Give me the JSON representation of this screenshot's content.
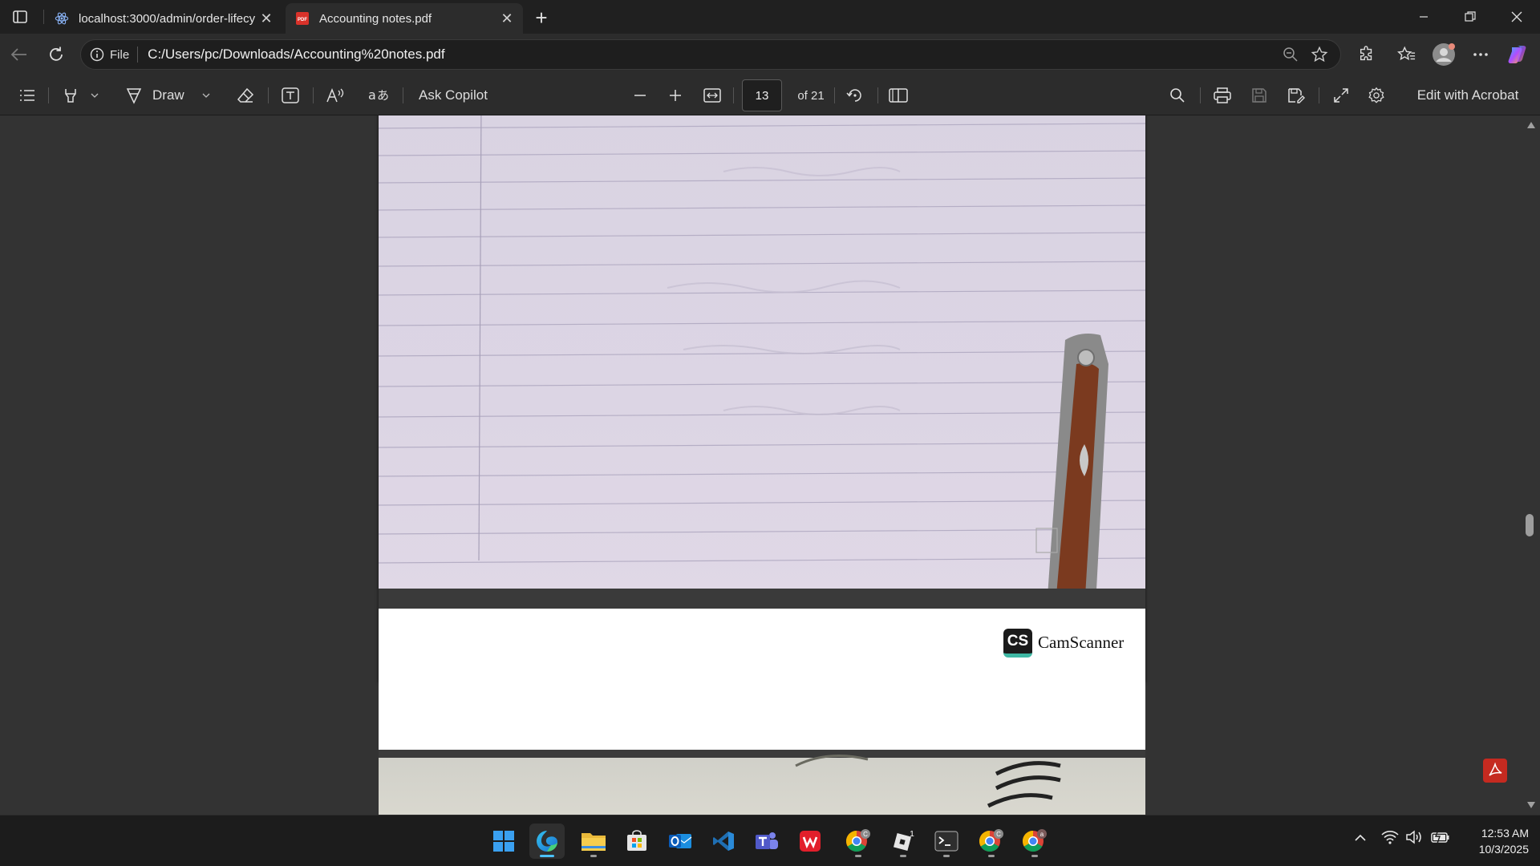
{
  "tabs": [
    {
      "title": "localhost:3000/admin/order-lifecy",
      "icon": "react-icon",
      "active": false
    },
    {
      "title": "Accounting notes.pdf",
      "icon": "pdf-icon",
      "active": true
    }
  ],
  "address": {
    "scheme_label": "File",
    "url": "C:/Users/pc/Downloads/Accounting%20notes.pdf"
  },
  "pdf_toolbar": {
    "draw_label": "Draw",
    "ask_copilot_label": "Ask Copilot",
    "current_page": "13",
    "page_count_label": "of 21",
    "edit_with_acrobat_label": "Edit with Acrobat"
  },
  "document": {
    "watermark_badge": "CS",
    "watermark_text": "CamScanner"
  },
  "taskbar": {
    "apps": [
      "windows-start",
      "edge",
      "file-explorer",
      "microsoft-store",
      "outlook",
      "vs-code",
      "teams",
      "wps-office",
      "chrome-profile-c",
      "app-badge-1",
      "terminal",
      "chrome-profile-c-2",
      "chrome-profile-a"
    ],
    "badge_count": "1"
  },
  "clock": {
    "time": "12:53 AM",
    "date": "10/3/2025"
  },
  "colors": {
    "accent": "#4cc2ff",
    "pdf_red": "#c52a20",
    "camscanner_teal": "#3fb8a4"
  }
}
